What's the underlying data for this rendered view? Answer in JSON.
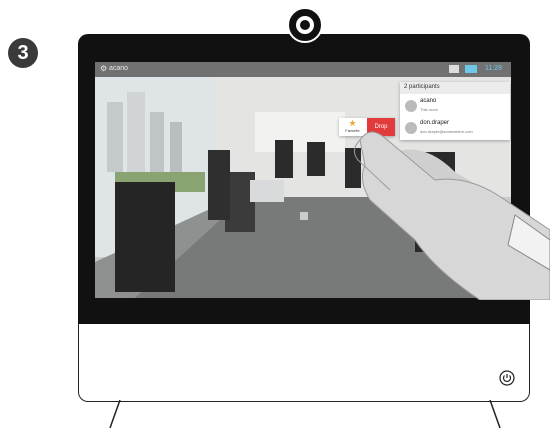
{
  "step_badge": "3",
  "screen": {
    "call_name": "acano",
    "clock": "11:28",
    "participants_panel": {
      "title": "2 participants",
      "items": [
        {
          "name": "acano",
          "detail": "This room"
        },
        {
          "name": "don.draper",
          "detail": "don.draper@somewhere.com"
        }
      ]
    },
    "popup": {
      "favorite_label": "Favorite",
      "drop_label": "Drop"
    }
  },
  "colors": {
    "accent": "#6cc7e8",
    "drop": "#e23b3b",
    "favorite_star": "#f2a23a"
  },
  "icons": [
    "camera-icon",
    "gear-icon",
    "star-icon",
    "power-icon",
    "hand-pointer"
  ]
}
